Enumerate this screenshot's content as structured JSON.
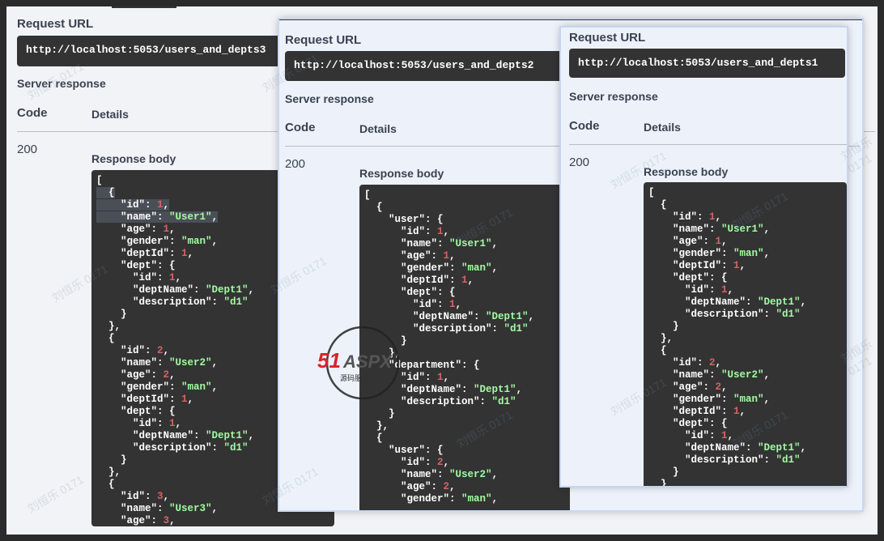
{
  "panels": [
    {
      "id": "p3",
      "request_url_label": "Request URL",
      "url": "http://localhost:5053/users_and_depts3",
      "server_response_label": "Server response",
      "code_header": "Code",
      "details_header": "Details",
      "code": "200",
      "response_body_label": "Response body",
      "body_lines": [
        "[",
        "  {",
        "    \"id\": 1,",
        "    \"name\": \"User1\",",
        "    \"age\": 1,",
        "    \"gender\": \"man\",",
        "    \"deptId\": 1,",
        "    \"dept\": {",
        "      \"id\": 1,",
        "      \"deptName\": \"Dept1\",",
        "      \"description\": \"d1\"",
        "    }",
        "  },",
        "  {",
        "    \"id\": 2,",
        "    \"name\": \"User2\",",
        "    \"age\": 2,",
        "    \"gender\": \"man\",",
        "    \"deptId\": 1,",
        "    \"dept\": {",
        "      \"id\": 1,",
        "      \"deptName\": \"Dept1\",",
        "      \"description\": \"d1\"",
        "    }",
        "  },",
        "  {",
        "    \"id\": 3,",
        "    \"name\": \"User3\",",
        "    \"age\": 3,"
      ]
    },
    {
      "id": "p2",
      "request_url_label": "Request URL",
      "url": "http://localhost:5053/users_and_depts2",
      "server_response_label": "Server response",
      "code_header": "Code",
      "details_header": "Details",
      "code": "200",
      "response_body_label": "Response body",
      "body_lines": [
        "[",
        "  {",
        "    \"user\": {",
        "      \"id\": 1,",
        "      \"name\": \"User1\",",
        "      \"age\": 1,",
        "      \"gender\": \"man\",",
        "      \"deptId\": 1,",
        "      \"dept\": {",
        "        \"id\": 1,",
        "        \"deptName\": \"Dept1\",",
        "        \"description\": \"d1\"",
        "      }",
        "    },",
        "    \"department\": {",
        "      \"id\": 1,",
        "      \"deptName\": \"Dept1\",",
        "      \"description\": \"d1\"",
        "    }",
        "  },",
        "  {",
        "    \"user\": {",
        "      \"id\": 2,",
        "      \"name\": \"User2\",",
        "      \"age\": 2,",
        "      \"gender\": \"man\","
      ]
    },
    {
      "id": "p1",
      "request_url_label": "Request URL",
      "url": "http://localhost:5053/users_and_depts1",
      "server_response_label": "Server response",
      "code_header": "Code",
      "details_header": "Details",
      "code": "200",
      "response_body_label": "Response body",
      "body_lines": [
        "[",
        "  {",
        "    \"id\": 1,",
        "    \"name\": \"User1\",",
        "    \"age\": 1,",
        "    \"gender\": \"man\",",
        "    \"deptId\": 1,",
        "    \"dept\": {",
        "      \"id\": 1,",
        "      \"deptName\": \"Dept1\",",
        "      \"description\": \"d1\"",
        "    }",
        "  },",
        "  {",
        "    \"id\": 2,",
        "    \"name\": \"User2\",",
        "    \"age\": 2,",
        "    \"gender\": \"man\",",
        "    \"deptId\": 1,",
        "    \"dept\": {",
        "      \"id\": 1,",
        "      \"deptName\": \"Dept1\",",
        "      \"description\": \"d1\"",
        "    }",
        "  }"
      ]
    }
  ],
  "watermark": {
    "text": "刘恒乐 0171",
    "logo_text": "51ASPX",
    "logo_subtext": "源码服务平台"
  },
  "colors": {
    "string": "#a2fca2",
    "number": "#d36363",
    "code_bg": "#333333"
  }
}
